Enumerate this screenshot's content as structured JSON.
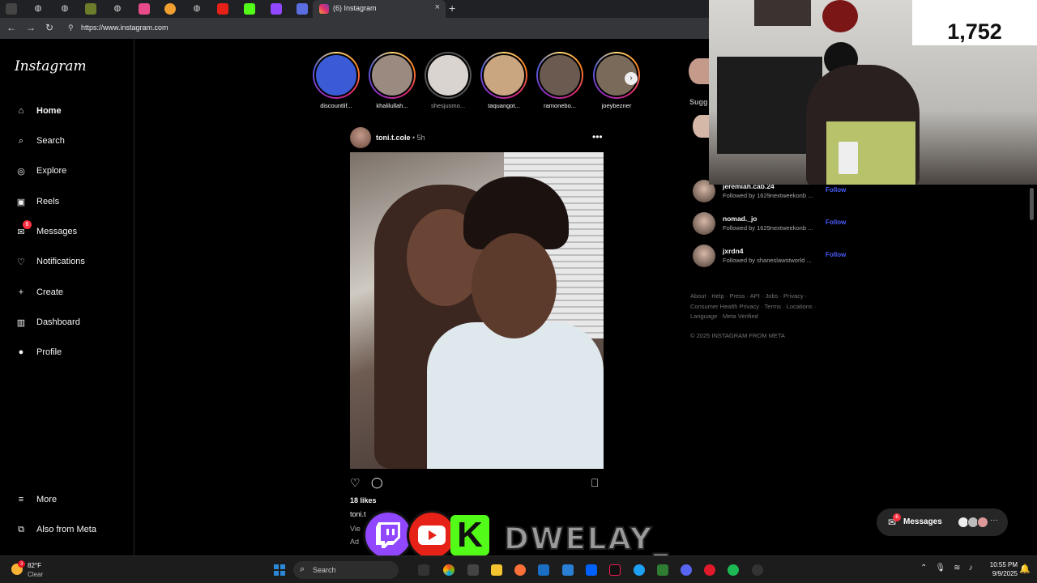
{
  "browser": {
    "active_tab_title": "(6) Instagram",
    "new_tab": "+",
    "close_tab": "×",
    "url": "https://www.instagram.com",
    "back": "←",
    "forward": "→",
    "reload": "↻"
  },
  "sidebar": {
    "logo": "Instagram",
    "items": [
      {
        "label": "Home",
        "icon": "home-icon",
        "glyph": "⌂"
      },
      {
        "label": "Search",
        "icon": "search-icon",
        "glyph": "⌕"
      },
      {
        "label": "Explore",
        "icon": "compass-icon",
        "glyph": "◎"
      },
      {
        "label": "Reels",
        "icon": "reels-icon",
        "glyph": "▣"
      },
      {
        "label": "Messages",
        "icon": "messenger-icon",
        "glyph": "✉",
        "badge": "6"
      },
      {
        "label": "Notifications",
        "icon": "heart-icon",
        "glyph": "♡"
      },
      {
        "label": "Create",
        "icon": "plus-icon",
        "glyph": "+"
      },
      {
        "label": "Dashboard",
        "icon": "chart-icon",
        "glyph": "▥"
      },
      {
        "label": "Profile",
        "icon": "avatar-icon",
        "glyph": "●"
      }
    ],
    "more": "More",
    "more_glyph": "≡",
    "also_from_meta": "Also from Meta",
    "also_glyph": "⧉"
  },
  "stories": [
    {
      "name": "discountlif...",
      "seen": false
    },
    {
      "name": "khalilullah...",
      "seen": false
    },
    {
      "name": "shesjusmo...",
      "seen": true
    },
    {
      "name": "taquangot...",
      "seen": false
    },
    {
      "name": "ramonebo...",
      "seen": false
    },
    {
      "name": "joeybezner",
      "seen": false
    }
  ],
  "stories_next": "›",
  "post": {
    "username": "toni.t.cole",
    "time": "• 5h",
    "more": "•••",
    "likes": "18 likes",
    "caption_user": "toni.t",
    "view_all": "Vie",
    "add_comment": "Ad",
    "like_glyph": "♡",
    "comment_glyph": "◯",
    "save_glyph": "⎕"
  },
  "suggestions": {
    "title": "Sugg",
    "items": [
      {
        "username": "jeremiah.cab.24",
        "subtitle": "Followed by 1629nextweekonb ...",
        "action": "Follow"
      },
      {
        "username": "nomad._jo",
        "subtitle": "Followed by 1629nextweekonb ...",
        "action": "Follow"
      },
      {
        "username": "jxrdn4",
        "subtitle": "Followed by shaneslawstworld ...",
        "action": "Follow"
      }
    ]
  },
  "footer": {
    "lines": [
      "About · Help · Press · API · Jobs · Privacy ·",
      "Consumer Health Privacy · Terms · Locations ·",
      "Language · Meta Verified"
    ],
    "copyright": "© 2025 INSTAGRAM FROM META"
  },
  "stream_overlay": {
    "counter": "1,752",
    "brand_text": "DWELAY_",
    "kick_letter": "K"
  },
  "messages_pill": {
    "label": "Messages",
    "badge": "6",
    "more": "···"
  },
  "taskbar": {
    "weather_temp": "82°F",
    "weather_cond": "Clear",
    "weather_badge": "3",
    "search_label": "Search",
    "time": "10:55 PM",
    "date": "9/9/2025"
  },
  "colors": {
    "background": "#000000",
    "link_blue": "#4a5df9",
    "badge_red": "#ff3040",
    "twitch": "#9146ff",
    "youtube": "#e62117",
    "kick": "#53fc18"
  }
}
